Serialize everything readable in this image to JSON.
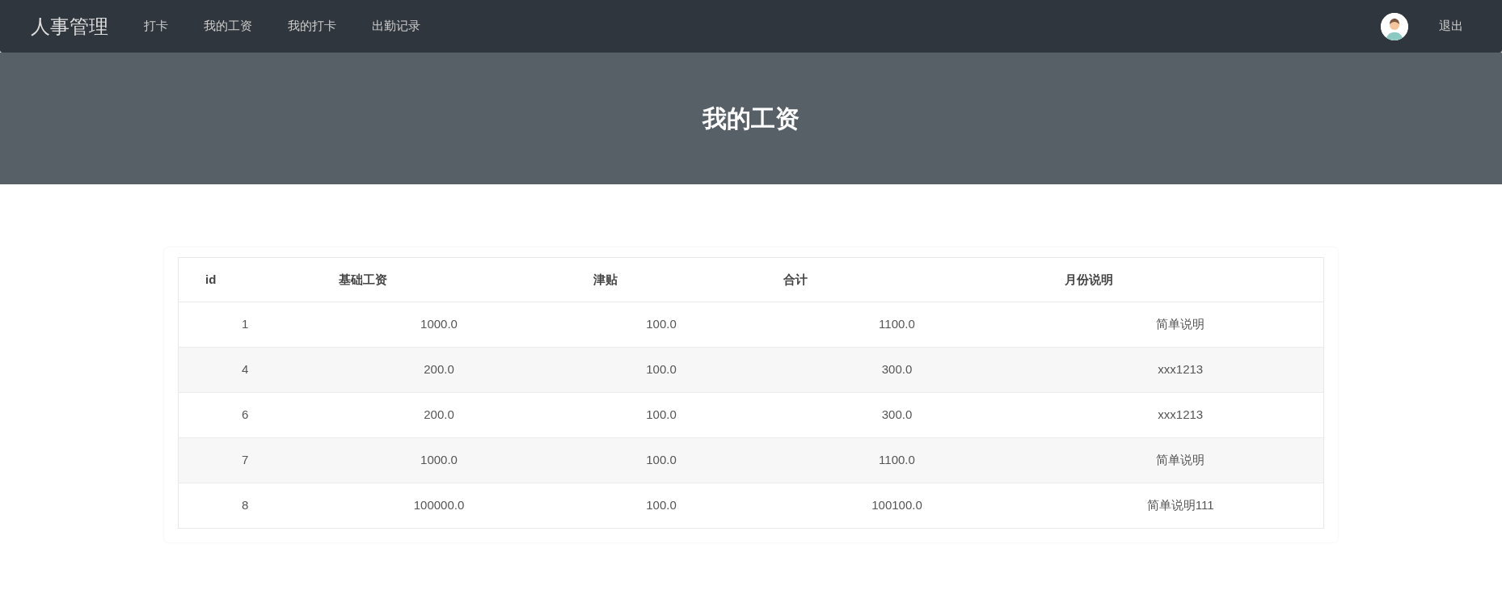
{
  "navbar": {
    "brand": "人事管理",
    "items": [
      {
        "label": "打卡",
        "selected": false
      },
      {
        "label": "我的工资",
        "selected": false
      },
      {
        "label": "我的打卡",
        "selected": false
      },
      {
        "label": "出勤记录",
        "selected": false
      }
    ],
    "logout": "退出"
  },
  "header": {
    "title": "我的工资"
  },
  "table": {
    "columns": [
      "id",
      "基础工资",
      "津贴",
      "合计",
      "月份说明"
    ],
    "rows": [
      [
        "1",
        "1000.0",
        "100.0",
        "1100.0",
        "简单说明"
      ],
      [
        "4",
        "200.0",
        "100.0",
        "300.0",
        "xxx1213"
      ],
      [
        "6",
        "200.0",
        "100.0",
        "300.0",
        "xxx1213"
      ],
      [
        "7",
        "1000.0",
        "100.0",
        "1100.0",
        "简单说明"
      ],
      [
        "8",
        "100000.0",
        "100.0",
        "100100.0",
        "简单说明111"
      ]
    ]
  }
}
